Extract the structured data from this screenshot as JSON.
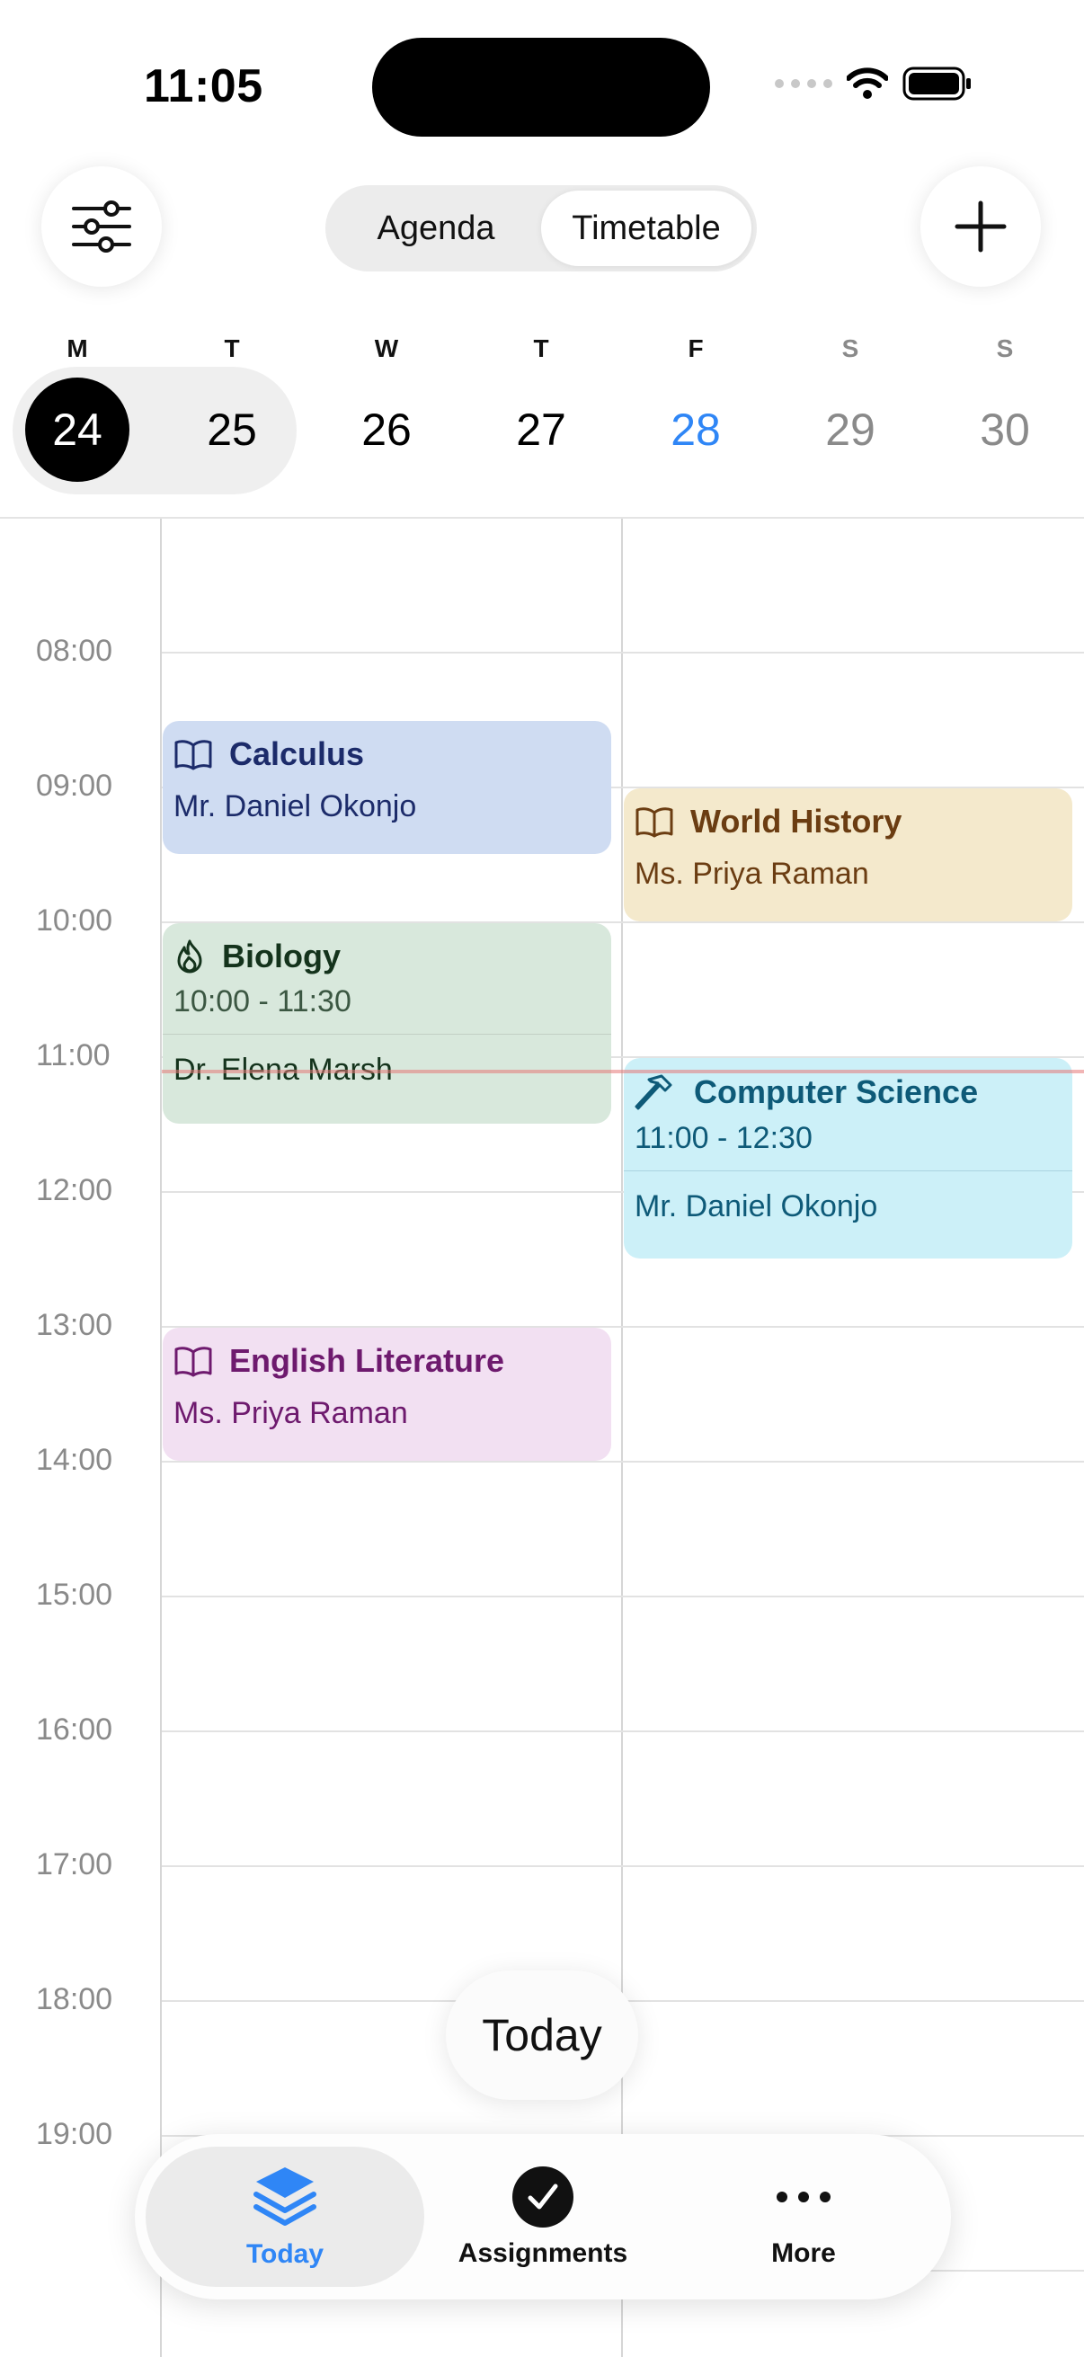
{
  "status_bar": {
    "time": "11:05"
  },
  "header": {
    "filter_icon": "sliders-icon",
    "add_icon": "plus-icon",
    "segments": [
      {
        "label": "Agenda",
        "active": false
      },
      {
        "label": "Timetable",
        "active": true
      }
    ]
  },
  "week": {
    "days": [
      {
        "letter": "M",
        "num": "24",
        "state": "selected"
      },
      {
        "letter": "T",
        "num": "25",
        "state": "in-range"
      },
      {
        "letter": "W",
        "num": "26",
        "state": "normal"
      },
      {
        "letter": "T",
        "num": "27",
        "state": "normal"
      },
      {
        "letter": "F",
        "num": "28",
        "state": "today"
      },
      {
        "letter": "S",
        "num": "29",
        "state": "weekend"
      },
      {
        "letter": "S",
        "num": "30",
        "state": "weekend"
      }
    ]
  },
  "timetable": {
    "hours": [
      "08:00",
      "09:00",
      "10:00",
      "11:00",
      "12:00",
      "13:00",
      "14:00",
      "15:00",
      "16:00",
      "17:00",
      "18:00",
      "19:00"
    ],
    "now": "11:05",
    "events": [
      {
        "title": "Calculus",
        "teacher": "Mr. Daniel Okonjo",
        "icon": "book-icon",
        "color": "#cfdcf2",
        "text_color": "#1c2b6a"
      },
      {
        "title": "World History",
        "teacher": "Ms. Priya Raman",
        "icon": "book-icon",
        "color": "#f4e9cc",
        "text_color": "#6b3d12"
      },
      {
        "title": "Biology",
        "time": "10:00 - 11:30",
        "teacher": "Dr. Elena Marsh",
        "icon": "flame-icon",
        "color": "#d8e8dc",
        "text_color": "#14331c"
      },
      {
        "title": "Computer Science",
        "time": "11:00 - 12:30",
        "teacher": "Mr. Daniel Okonjo",
        "icon": "hammer-icon",
        "color": "#ccf0f8",
        "text_color": "#0e5a78"
      },
      {
        "title": "English Literature",
        "teacher": "Ms. Priya Raman",
        "icon": "book-icon",
        "color": "#f2e0f2",
        "text_color": "#6e1a6e"
      }
    ]
  },
  "floating": {
    "today_label": "Today"
  },
  "tabbar": {
    "tabs": [
      {
        "label": "Today",
        "icon": "stack-icon",
        "active": true
      },
      {
        "label": "Assignments",
        "icon": "checkmark-circle-icon",
        "active": false
      },
      {
        "label": "More",
        "icon": "ellipsis-icon",
        "active": false
      }
    ]
  },
  "colors": {
    "accent": "#2f86f6",
    "now_line": "#e67878"
  }
}
